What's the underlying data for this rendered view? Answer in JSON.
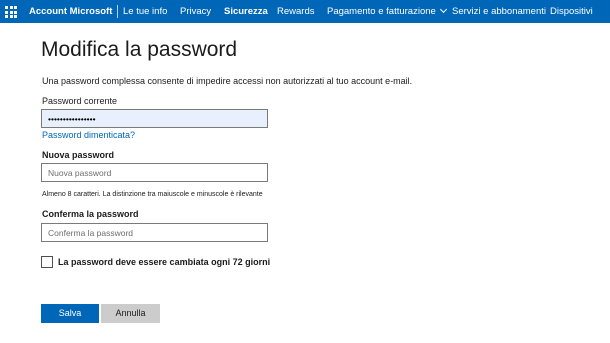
{
  "header": {
    "brand": "Account Microsoft",
    "nav": [
      {
        "label": "Le tue info",
        "active": false
      },
      {
        "label": "Privacy",
        "active": false
      },
      {
        "label": "Sicurezza",
        "active": true
      },
      {
        "label": "Rewards",
        "active": false
      },
      {
        "label": "Pagamento e fatturazione",
        "active": false,
        "dropdown": true
      },
      {
        "label": "Servizi e abbonamenti",
        "active": false
      },
      {
        "label": "Dispositivi",
        "active": false
      }
    ]
  },
  "form": {
    "title": "Modifica la password",
    "description": "Una password complessa consente di impedire accessi non autorizzati al tuo account e-mail.",
    "current_password": {
      "label": "Password corrente",
      "value": "••••••••••••••••"
    },
    "forgot_link": "Password dimenticata?",
    "new_password": {
      "label": "Nuova password",
      "placeholder": "Nuova password",
      "hint": "Almeno 8 caratteri. La distinzione tra maiuscole e minuscole è rilevante"
    },
    "confirm_password": {
      "label": "Conferma la password",
      "placeholder": "Conferma la password"
    },
    "expire_checkbox": {
      "label": "La password deve essere cambiata ogni 72 giorni",
      "checked": false
    },
    "save_label": "Salva",
    "cancel_label": "Annulla"
  },
  "colors": {
    "brand_blue": "#0067b8",
    "cancel_gray": "#cccccc"
  }
}
